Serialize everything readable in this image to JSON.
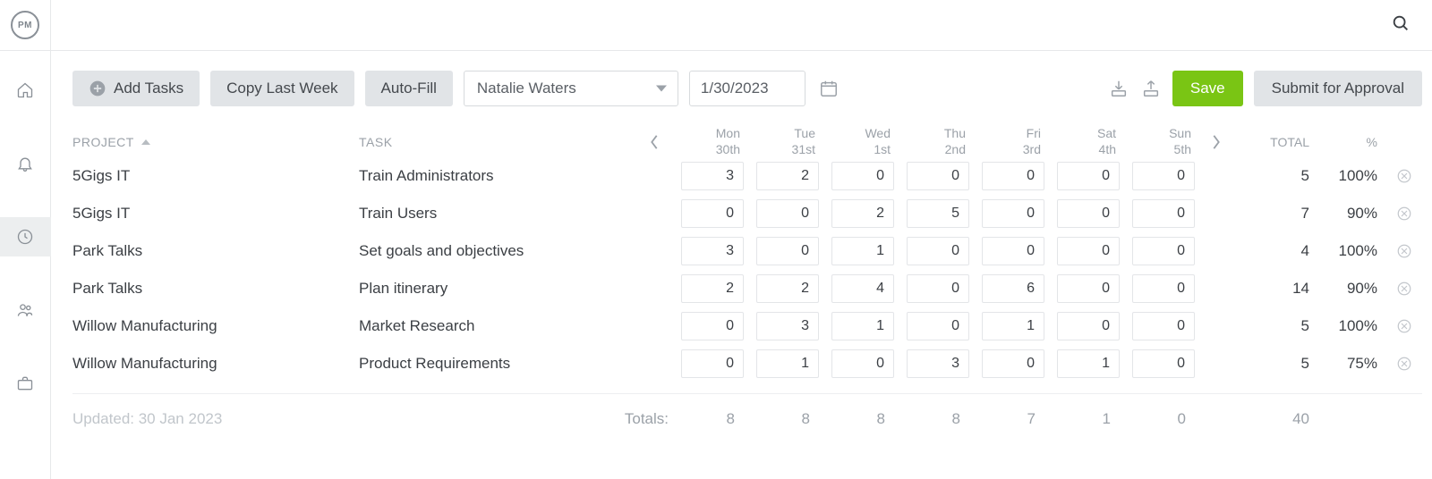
{
  "logo_text": "PM",
  "toolbar": {
    "add_label": "Add Tasks",
    "copy_label": "Copy Last Week",
    "autofill_label": "Auto-Fill",
    "user_selected": "Natalie Waters",
    "date_value": "1/30/2023",
    "save_label": "Save",
    "submit_label": "Submit for Approval"
  },
  "columns": {
    "project": "PROJECT",
    "task": "TASK",
    "days": [
      {
        "dow": "Mon",
        "dom": "30th"
      },
      {
        "dow": "Tue",
        "dom": "31st"
      },
      {
        "dow": "Wed",
        "dom": "1st"
      },
      {
        "dow": "Thu",
        "dom": "2nd"
      },
      {
        "dow": "Fri",
        "dom": "3rd"
      },
      {
        "dow": "Sat",
        "dom": "4th"
      },
      {
        "dow": "Sun",
        "dom": "5th"
      }
    ],
    "total": "TOTAL",
    "pct": "%"
  },
  "rows": [
    {
      "project": "5Gigs IT",
      "task": "Train Administrators",
      "values": [
        "3",
        "2",
        "0",
        "0",
        "0",
        "0",
        "0"
      ],
      "total": "5",
      "pct": "100%"
    },
    {
      "project": "5Gigs IT",
      "task": "Train Users",
      "values": [
        "0",
        "0",
        "2",
        "5",
        "0",
        "0",
        "0"
      ],
      "total": "7",
      "pct": "90%"
    },
    {
      "project": "Park Talks",
      "task": "Set goals and objectives",
      "values": [
        "3",
        "0",
        "1",
        "0",
        "0",
        "0",
        "0"
      ],
      "total": "4",
      "pct": "100%"
    },
    {
      "project": "Park Talks",
      "task": "Plan itinerary",
      "values": [
        "2",
        "2",
        "4",
        "0",
        "6",
        "0",
        "0"
      ],
      "total": "14",
      "pct": "90%"
    },
    {
      "project": "Willow Manufacturing",
      "task": "Market Research",
      "values": [
        "0",
        "3",
        "1",
        "0",
        "1",
        "0",
        "0"
      ],
      "total": "5",
      "pct": "100%"
    },
    {
      "project": "Willow Manufacturing",
      "task": "Product Requirements",
      "values": [
        "0",
        "1",
        "0",
        "3",
        "0",
        "1",
        "0"
      ],
      "total": "5",
      "pct": "75%"
    }
  ],
  "totals": {
    "label": "Totals:",
    "values": [
      "8",
      "8",
      "8",
      "8",
      "7",
      "1",
      "0"
    ],
    "grand": "40"
  },
  "footer": {
    "updated": "Updated: 30 Jan 2023"
  }
}
